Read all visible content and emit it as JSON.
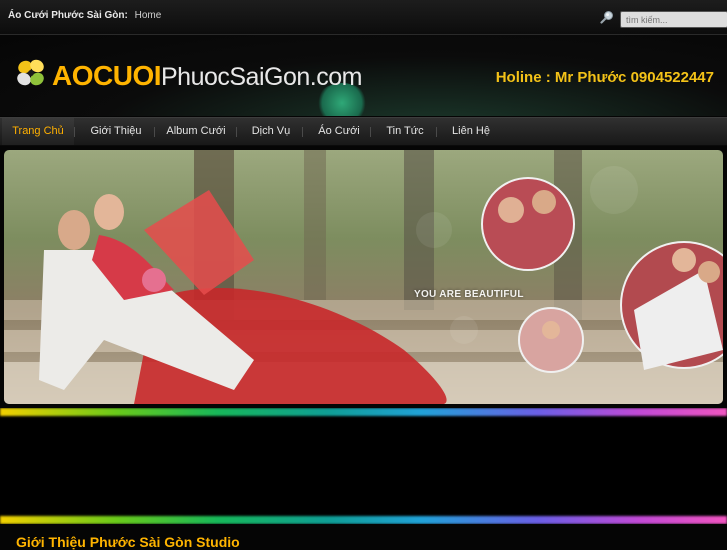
{
  "topbar": {
    "site_name": "Áo Cưới Phước Sài Gòn:",
    "home_link": "Home",
    "search_placeholder": "tìm kiếm..."
  },
  "header": {
    "logo_bold": "AOCUOI",
    "logo_thin": "PhuocSaiGon.com",
    "hotline": "Holine : Mr Phước 0904522447"
  },
  "nav": {
    "items": [
      {
        "label": "Trang Chủ",
        "active": true
      },
      {
        "label": "Giới Thiệu",
        "active": false
      },
      {
        "label": "Album Cưới",
        "active": false
      },
      {
        "label": "Dịch Vụ",
        "active": false
      },
      {
        "label": "Áo Cưới",
        "active": false
      },
      {
        "label": "Tin Tức",
        "active": false
      },
      {
        "label": "Liên Hệ",
        "active": false
      }
    ]
  },
  "banner": {
    "tagline": "YOU ARE BEAUTIFUL"
  },
  "content": {
    "section_title": "Giới Thiệu Phước Sài Gòn Studio"
  },
  "colors": {
    "accent": "#ffb400",
    "hotline": "#f3c218",
    "background": "#050505"
  }
}
